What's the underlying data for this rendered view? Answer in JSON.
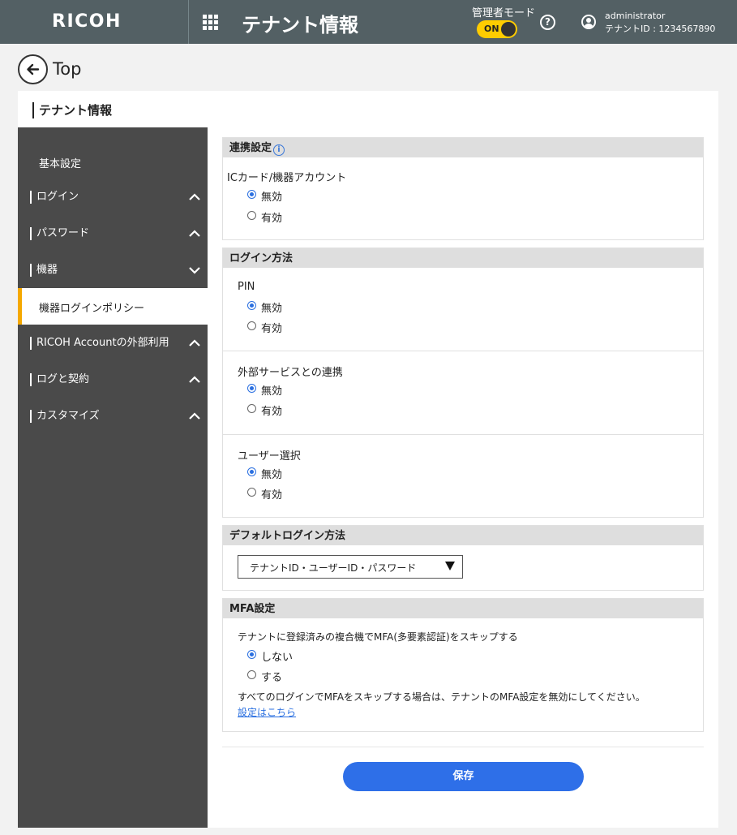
{
  "header": {
    "logo": "RICOH",
    "title": "テナント情報",
    "admin_mode_label": "管理者モード",
    "admin_toggle": "ON",
    "user_name": "administrator",
    "tenant_id": "テナントID : 1234567890"
  },
  "nav": {
    "back_label": "Top"
  },
  "page": {
    "title": "テナント情報"
  },
  "sidebar": {
    "items": [
      {
        "label": "基本設定"
      },
      {
        "label": "ログイン"
      },
      {
        "label": "パスワード"
      },
      {
        "label": "機器"
      },
      {
        "label": "機器ログインポリシー"
      },
      {
        "label": "RICOH Accountの外部利用"
      },
      {
        "label": "ログと契約"
      },
      {
        "label": "カスタマイズ"
      }
    ]
  },
  "sections": {
    "linkage": {
      "title": "連携設定",
      "field_label": "ICカード/機器アカウント",
      "options": [
        "無効",
        "有効"
      ],
      "selected": "無効"
    },
    "login_method": {
      "title": "ログイン方法",
      "groups": [
        {
          "label": "PIN",
          "options": [
            "無効",
            "有効"
          ],
          "selected": "無効"
        },
        {
          "label": "外部サービスとの連携",
          "options": [
            "無効",
            "有効"
          ],
          "selected": "無効"
        },
        {
          "label": "ユーザー選択",
          "options": [
            "無効",
            "有効"
          ],
          "selected": "無効"
        }
      ]
    },
    "default_login": {
      "title": "デフォルトログイン方法",
      "selected_value": "テナントID・ユーザーID・パスワード"
    },
    "mfa": {
      "title": "MFA設定",
      "field_label": "テナントに登録済みの複合機でMFA(多要素認証)をスキップする",
      "options": [
        "しない",
        "する"
      ],
      "selected": "しない",
      "note": "すべてのログインでMFAをスキップする場合は、テナントのMFA設定を無効にしてください。",
      "link": "設定はこちら"
    }
  },
  "actions": {
    "save_label": "保存"
  },
  "colors": {
    "header_bg": "#536064",
    "sidebar_bg": "#4a4a4a",
    "accent": "#2e6fe8",
    "toggle": "#ffcc00",
    "active_bar": "#f5a800"
  }
}
